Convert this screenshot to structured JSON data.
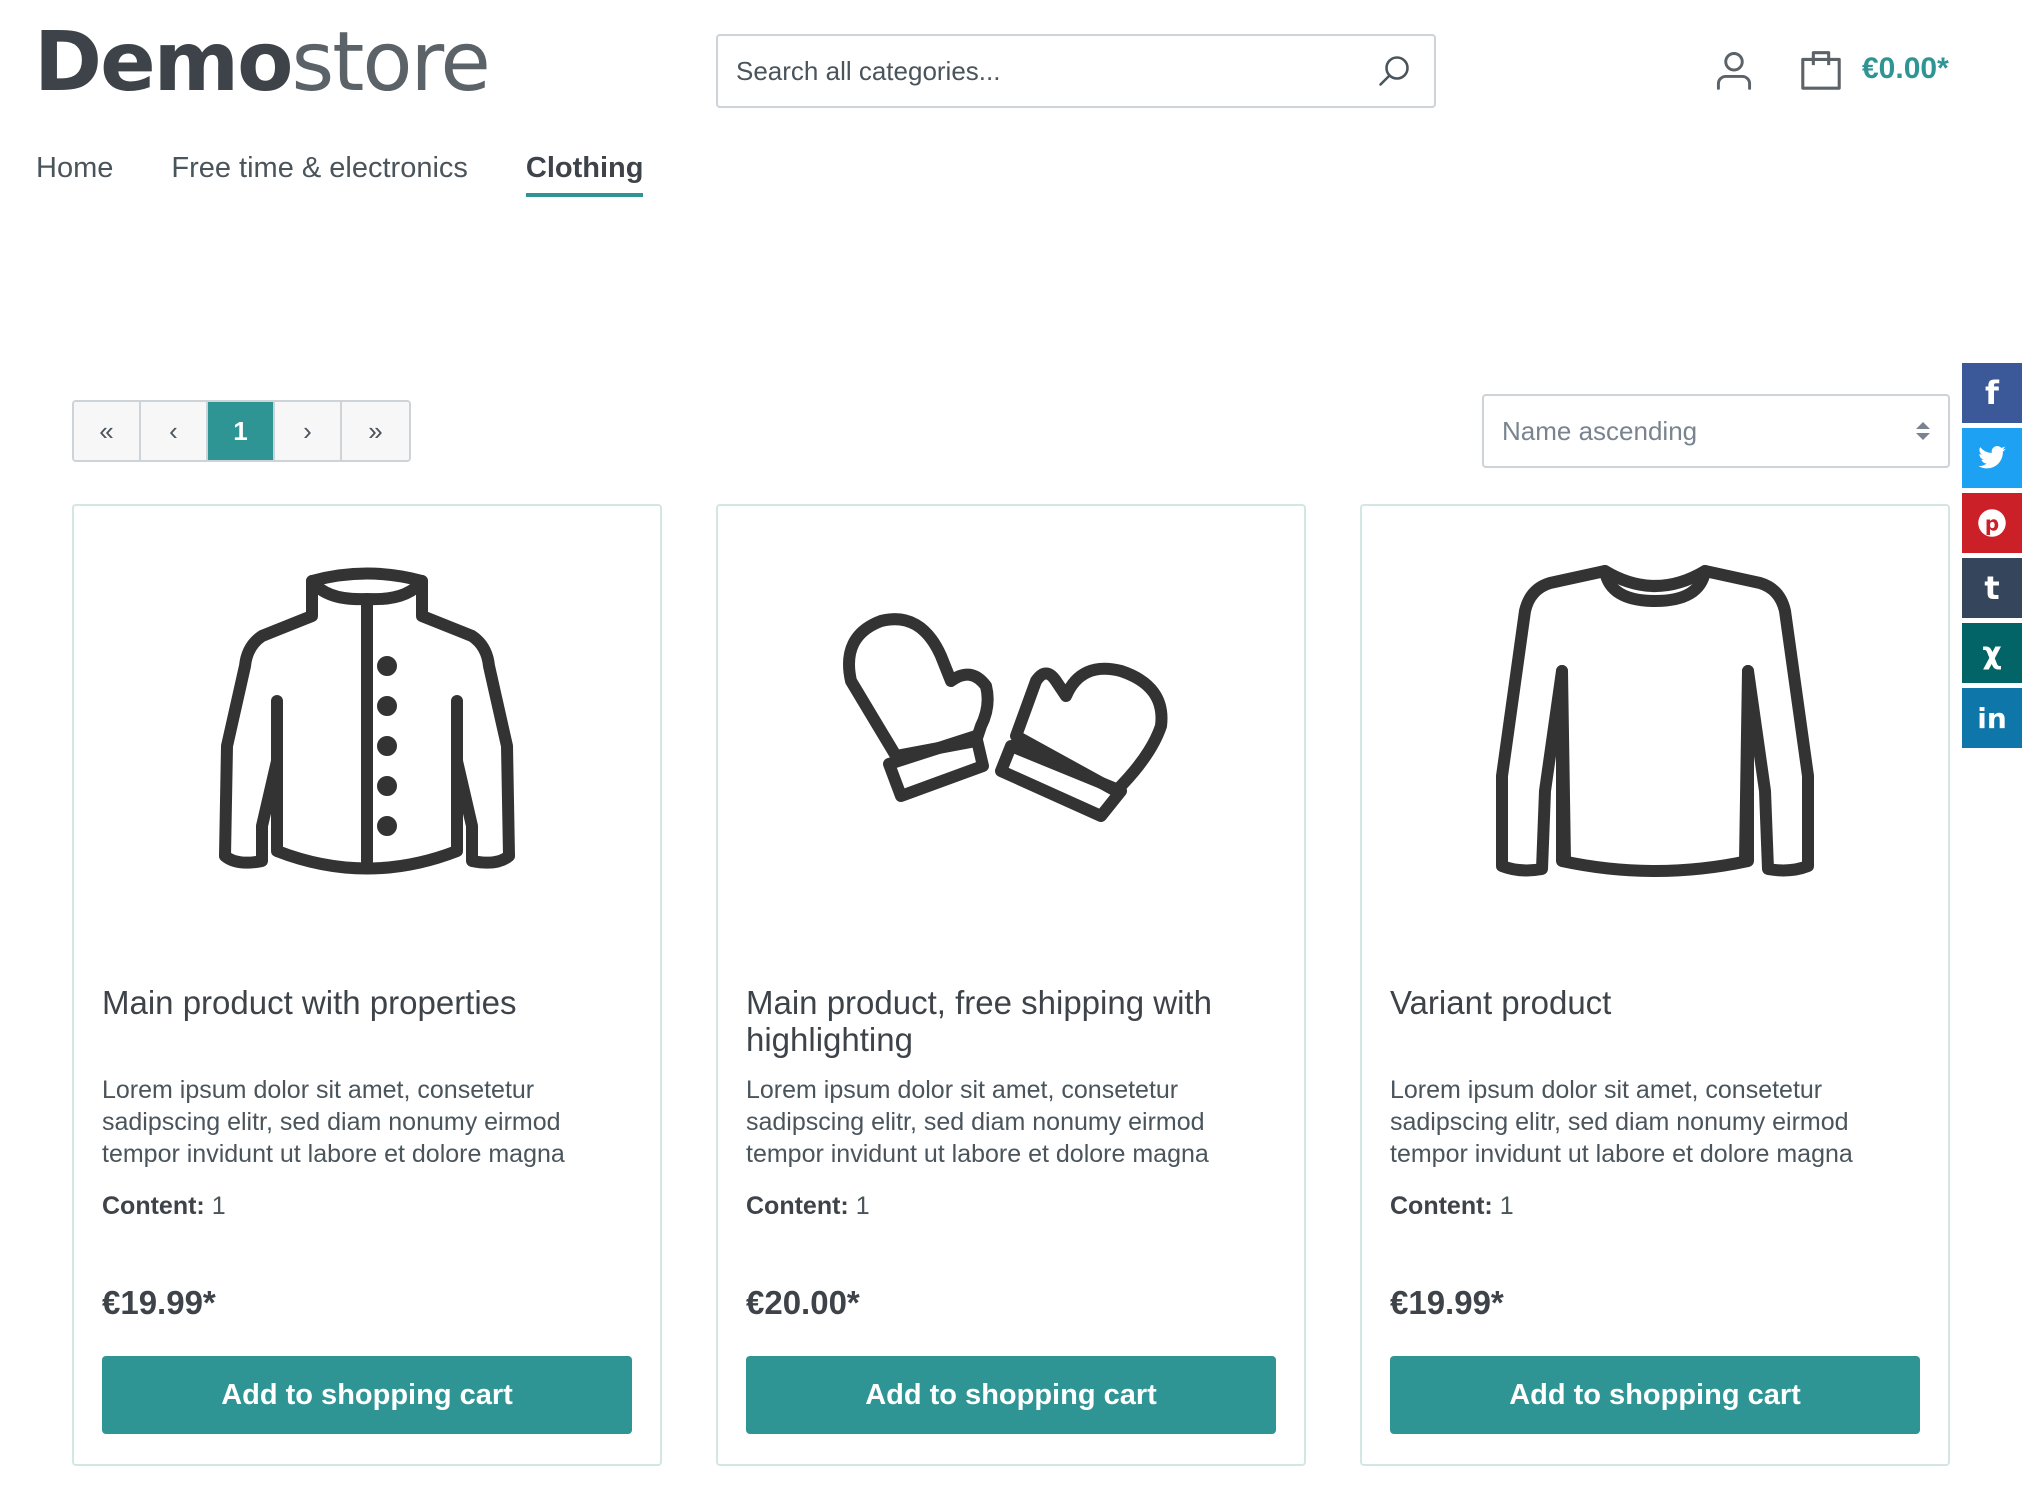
{
  "header": {
    "logo_bold": "Demo",
    "logo_light": "store",
    "search_placeholder": "Search all categories...",
    "cart_total": "€0.00*"
  },
  "nav": {
    "items": [
      {
        "label": "Home",
        "active": false
      },
      {
        "label": "Free time & electronics",
        "active": false
      },
      {
        "label": "Clothing",
        "active": true
      }
    ]
  },
  "pagination": {
    "first": "«",
    "prev": "‹",
    "current": "1",
    "next": "›",
    "last": "»"
  },
  "sorting": {
    "selected": "Name ascending"
  },
  "social": [
    {
      "name": "facebook",
      "glyph": "f",
      "color": "#3b5998"
    },
    {
      "name": "twitter",
      "glyph": "t-bird",
      "color": "#1da1f2"
    },
    {
      "name": "pinterest",
      "glyph": "p",
      "color": "#cb2027"
    },
    {
      "name": "tumblr",
      "glyph": "t",
      "color": "#35465c"
    },
    {
      "name": "xing",
      "glyph": "x",
      "color": "#026466"
    },
    {
      "name": "linkedin",
      "glyph": "in",
      "color": "#0e76a8"
    }
  ],
  "products": [
    {
      "title": "Main product with properties",
      "description": "Lorem ipsum dolor sit amet, consetetur sadipscing elitr, sed diam nonumy eirmod tempor invidunt ut labore et dolore magna",
      "content_label": "Content:",
      "content_value": " 1",
      "price": "€19.99*",
      "button": "Add to shopping cart",
      "icon": "jacket-icon"
    },
    {
      "title": "Main product, free shipping with highlighting",
      "description": "Lorem ipsum dolor sit amet, consetetur sadipscing elitr, sed diam nonumy eirmod tempor invidunt ut labore et dolore magna",
      "content_label": "Content:",
      "content_value": " 1",
      "price": "€20.00*",
      "button": "Add to shopping cart",
      "icon": "mittens-icon"
    },
    {
      "title": "Variant product",
      "description": "Lorem ipsum dolor sit amet, consetetur sadipscing elitr, sed diam nonumy eirmod tempor invidunt ut labore et dolore magna",
      "content_label": "Content:",
      "content_value": " 1",
      "price": "€19.99*",
      "button": "Add to shopping cart",
      "icon": "sweater-icon"
    }
  ],
  "colors": {
    "accent": "#2e9494",
    "text": "#4a545b",
    "border": "#cdd3d7"
  }
}
